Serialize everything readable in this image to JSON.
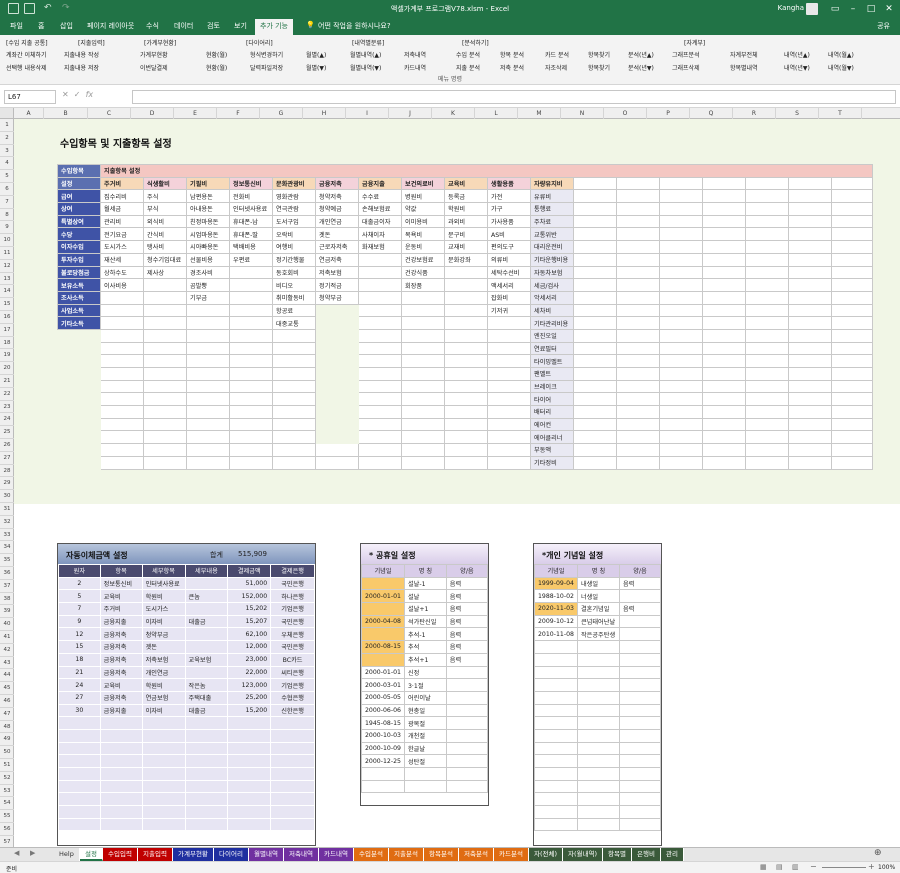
{
  "window": {
    "title": "액셀가계부 프로그램V78.xlsm  -  Excel",
    "user": "Kangha"
  },
  "ribbon_tabs": [
    "파일",
    "홈",
    "삽입",
    "페이지 레이아웃",
    "수식",
    "데이터",
    "검토",
    "보기",
    "추가 기능",
    "어떤 작업을 원하시나요?"
  ],
  "ribbon_active": "추가 기능",
  "ribbon": {
    "r1": [
      "[수입 지출 공통]",
      "[지출입력]",
      "[가계부현황]",
      "[다이어리]",
      "[내역별분류]",
      "[분석하기]",
      "[자계부]"
    ],
    "r2": [
      "계좌간 이체하기",
      "지출내용 작성",
      "가계부현황",
      "현황(월)",
      "형식변경하기",
      "월별(▲)",
      "월별내역(▲)",
      "저축내역",
      "수입 분석",
      "항목 분석",
      "카드 분석",
      "항목찾기",
      "분석(년▲)",
      "그래프분석",
      "자계부전체",
      "내역(년▲)",
      "내역(월▲)"
    ],
    "r3": [
      "선택행 내용삭제",
      "지출내용 저장",
      "이번달결제",
      "현황(월)",
      "달력파일저장",
      "월별(▼)",
      "월별내역(▼)",
      "카드내역",
      "지출 분석",
      "저축 분석",
      "자조삭제",
      "항목찾기",
      "분석(년▼)",
      "그래프삭제",
      "항목별내역",
      "내역(년▼)",
      "내역(월▼)"
    ],
    "group_label": "메뉴 명령"
  },
  "formula_bar": {
    "name_box": "L67",
    "formula": ""
  },
  "columns": [
    "A",
    "B",
    "C",
    "D",
    "E",
    "F",
    "G",
    "H",
    "I",
    "J",
    "K",
    "L",
    "M",
    "N",
    "O",
    "P",
    "Q",
    "R",
    "S",
    "T"
  ],
  "rows": [
    "1",
    "2",
    "3",
    "4",
    "5",
    "6",
    "7",
    "8",
    "9",
    "10",
    "11",
    "12",
    "13",
    "14",
    "15",
    "16",
    "17",
    "18",
    "19",
    "20",
    "21",
    "22",
    "23",
    "24",
    "25",
    "26",
    "27",
    "28",
    "29",
    "30",
    "31",
    "32",
    "33",
    "34",
    "35",
    "36",
    "37",
    "38",
    "39",
    "40",
    "41",
    "42",
    "43",
    "44",
    "45",
    "46",
    "47",
    "48",
    "49",
    "50",
    "51",
    "52",
    "53",
    "54",
    "55",
    "56",
    "57"
  ],
  "section_title": "수입항목 및 지출항목 설정",
  "income": {
    "header": "수입항목",
    "subheader": "설정",
    "items": [
      "급여",
      "상여",
      "특별상여",
      "수당",
      "이자수입",
      "투자수입",
      "불로당첨금",
      "보유소득",
      "조사소득",
      "사업소득",
      "기타소득"
    ]
  },
  "expense": {
    "header": "지출항목 설정",
    "categories": [
      "주거비",
      "식생활비",
      "기필비",
      "정보통신비",
      "문화관광비",
      "금융저축",
      "금융지출",
      "보건의료비",
      "교육비",
      "생활용품",
      "자량유지비"
    ],
    "columns": [
      [
        "집수리비",
        "월세금",
        "관리비",
        "전기요금",
        "도시가스",
        "재산세",
        "상하수도",
        "이사비용"
      ],
      [
        "주식",
        "부식",
        "외식비",
        "간식비",
        "탱사비",
        "청수기임대료",
        "제사상"
      ],
      [
        "남편용돈",
        "아내용돈",
        "친정마용돈",
        "시엄마용돈",
        "시아빠용돈",
        "선물비용",
        "경조사비",
        "곰발뿡",
        "기부금"
      ],
      [
        "전화비",
        "인터넷사용료",
        "휴대폰-남",
        "휴대폰-딸",
        "택배비용",
        "우편료"
      ],
      [
        "영화관람",
        "연극관람",
        "도서구입",
        "오락비",
        "여행비",
        "정기간행물",
        "동호회비",
        "비디오",
        "취미활동비",
        "항공료",
        "대중교통"
      ],
      [
        "청약저축",
        "청약예금",
        "개인연금",
        "곗돈",
        "근로자저축",
        "연금저축",
        "저축보험",
        "정기적금",
        "청약부금"
      ],
      [
        "수수료",
        "손해보험료",
        "대출금이자",
        "사채이자",
        "화재보험"
      ],
      [
        "병원비",
        "약값",
        "이미용비",
        "목욕비",
        "운동비",
        "건강보험료",
        "건강식품",
        "회장품"
      ],
      [
        "등록금",
        "학원비",
        "과외비",
        "문구비",
        "교재비",
        "문화강좌"
      ],
      [
        "가전",
        "가구",
        "가사용품",
        "AS비",
        "편의도구",
        "의류비",
        "세탁수선비",
        "액세서리",
        "잡화비",
        "기저귀"
      ],
      [
        "유류비",
        "통행료",
        "주차료",
        "교통위반",
        "대리운전비",
        "기타운행비용",
        "자동차보험",
        "세금/검사",
        "악세서리",
        "세차비",
        "기타관리비용",
        "엔진오일",
        "연료필터",
        "타이밍벨트",
        "팬벨트",
        "브레이크",
        "타이어",
        "배터리",
        "에어컨",
        "에어클리너",
        "부동액",
        "기타정비"
      ]
    ]
  },
  "auto_transfer": {
    "title": "자동이체금액 설정",
    "total_label": "합계",
    "total": "515,909",
    "headers": [
      "원자",
      "항목",
      "세부항목",
      "세부내용",
      "결제금액",
      "결제은행"
    ],
    "rows": [
      [
        "2",
        "정보통신비",
        "인터넷사용료",
        "",
        "51,000",
        "국민은행"
      ],
      [
        "5",
        "교육비",
        "학원비",
        "큰놈",
        "152,000",
        "하나은행"
      ],
      [
        "7",
        "주거비",
        "도시가스",
        "",
        "15,202",
        "기업은행"
      ],
      [
        "9",
        "금융지출",
        "이자비",
        "대출금",
        "15,207",
        "국민은행"
      ],
      [
        "12",
        "금융저축",
        "청약부금",
        "",
        "62,100",
        "우체은행"
      ],
      [
        "15",
        "금융저축",
        "곗돈",
        "",
        "12,000",
        "국민은행"
      ],
      [
        "18",
        "금융저축",
        "저축보험",
        "교육보험",
        "23,000",
        "BC카드"
      ],
      [
        "21",
        "금융저축",
        "개인연금",
        "",
        "22,000",
        "씨티은행"
      ],
      [
        "24",
        "교육비",
        "학원비",
        "작은놈",
        "123,000",
        "기업은행"
      ],
      [
        "27",
        "금융저축",
        "연금보험",
        "주택대출",
        "25,200",
        "수협은행"
      ],
      [
        "30",
        "금융지출",
        "이자비",
        "대출금",
        "15,200",
        "신한은행"
      ]
    ]
  },
  "holidays": {
    "title": "* 공휴일 설정",
    "headers": [
      "기념일",
      "명 칭",
      "양/음"
    ],
    "rows": [
      [
        "",
        "설날-1",
        "음력"
      ],
      [
        "2000-01-01",
        "설날",
        "음력"
      ],
      [
        "",
        "설날+1",
        "음력"
      ],
      [
        "2000-04-08",
        "석가탄신일",
        "음력"
      ],
      [
        "",
        "추석-1",
        "음력"
      ],
      [
        "2000-08-15",
        "추석",
        "음력"
      ],
      [
        "",
        "추석+1",
        "음력"
      ],
      [
        "2000-01-01",
        "신정",
        ""
      ],
      [
        "2000-03-01",
        "3·1절",
        ""
      ],
      [
        "2000-05-05",
        "어린이날",
        ""
      ],
      [
        "2000-06-06",
        "현충일",
        ""
      ],
      [
        "1945-08-15",
        "광복절",
        ""
      ],
      [
        "2000-10-03",
        "개천절",
        ""
      ],
      [
        "2000-10-09",
        "한글날",
        ""
      ],
      [
        "2000-12-25",
        "성탄절",
        ""
      ]
    ]
  },
  "memorial": {
    "title": "*개인 기념일 설정",
    "headers": [
      "기념일",
      "명 칭",
      "양/음"
    ],
    "rows": [
      [
        "1999-09-04",
        "내생일",
        "음력"
      ],
      [
        "1988-10-02",
        "너생일",
        ""
      ],
      [
        "2020-11-03",
        "결혼기념일",
        "음력"
      ],
      [
        "2009-10-12",
        "큰넘태어난날",
        ""
      ],
      [
        "2010-11-08",
        "작은공주탄생",
        ""
      ]
    ]
  },
  "sheet_tabs": [
    {
      "label": "Help",
      "color": "#e6e6e6"
    },
    {
      "label": "설정",
      "color": "#ffffff"
    },
    {
      "label": "수입입력",
      "color": "#c00000"
    },
    {
      "label": "지출입력",
      "color": "#c00000"
    },
    {
      "label": "가계부현황",
      "color": "#1f2fa0"
    },
    {
      "label": "다이어리",
      "color": "#1f2fa0"
    },
    {
      "label": "월별내역",
      "color": "#7030a0"
    },
    {
      "label": "저축내역",
      "color": "#7030a0"
    },
    {
      "label": "카드내역",
      "color": "#7030a0"
    },
    {
      "label": "수입분석",
      "color": "#e06c12"
    },
    {
      "label": "지출분석",
      "color": "#e06c12"
    },
    {
      "label": "항목분석",
      "color": "#e06c12"
    },
    {
      "label": "저축분석",
      "color": "#e06c12"
    },
    {
      "label": "카드분석",
      "color": "#e06c12"
    },
    {
      "label": "자(전체)",
      "color": "#3a5a3a"
    },
    {
      "label": "자(월내역)",
      "color": "#3a5a3a"
    },
    {
      "label": "항목별",
      "color": "#3a5a3a"
    },
    {
      "label": "은행비",
      "color": "#3a5a3a"
    },
    {
      "label": "관리",
      "color": "#3a5a3a"
    }
  ],
  "status": {
    "ready": "준비",
    "zoom": "100%"
  }
}
